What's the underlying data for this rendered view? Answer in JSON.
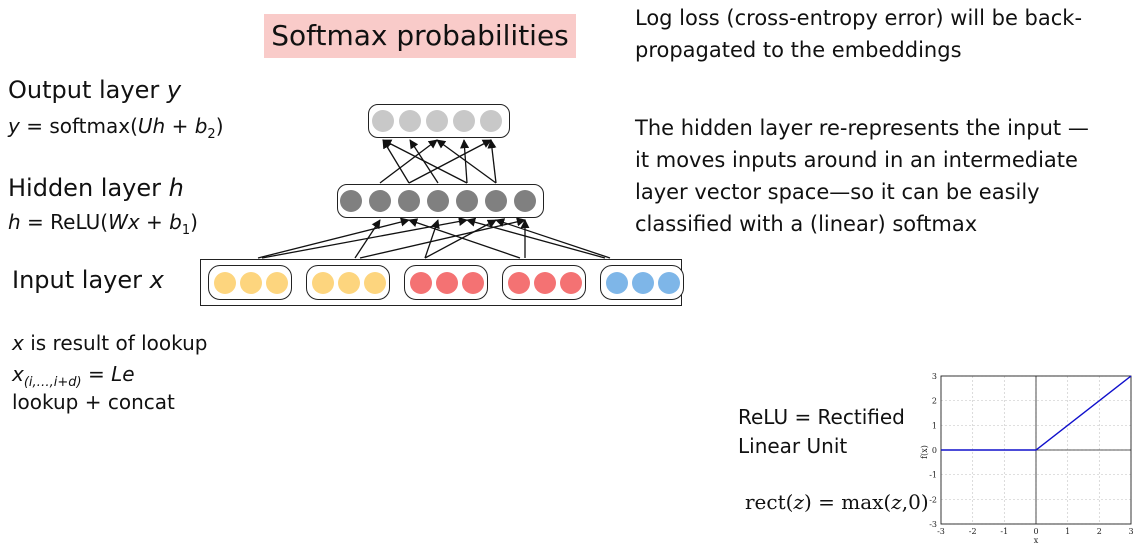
{
  "title": "Softmax probabilities",
  "right_text": {
    "loss_line1": "Log loss (cross-entropy error) will be back-",
    "loss_line2": "propagated to the embeddings",
    "hidden_line1": "The hidden layer re-represents the input —",
    "hidden_line2": "it moves inputs around in an intermediate",
    "hidden_line3": "layer vector space—so it can be easily",
    "hidden_line4": "classified with a (linear) softmax"
  },
  "layers": {
    "output_label": "Output layer ",
    "output_var": "y",
    "output_formula_lhs": "y",
    "output_formula_mid": " = softmax(",
    "output_formula_var": "Uh",
    "output_formula_rest": " + ",
    "output_formula_b": "b",
    "output_formula_sub": "2",
    "output_formula_end": ")",
    "hidden_label": "Hidden layer ",
    "hidden_var": "h",
    "hidden_formula_lhs": "h",
    "hidden_formula_mid": " = ReLU(",
    "hidden_formula_var": "Wx",
    "hidden_formula_rest": " + ",
    "hidden_formula_b": "b",
    "hidden_formula_sub": "1",
    "hidden_formula_end": ")",
    "input_label": "Input layer ",
    "input_var": "x"
  },
  "lookup": {
    "line1_var": "x",
    "line1_rest": " is result of lookup",
    "line2_var": "x",
    "line2_sub": "(i,…,i+d)",
    "line2_eq": " = ",
    "line2_rhs": "Le",
    "line3": "lookup + concat"
  },
  "relu": {
    "line1": "ReLU = Rectified",
    "line2": "Linear Unit",
    "formula_lhs": "rect(",
    "formula_z1": "z",
    "formula_mid": ") = max(",
    "formula_z2": "z",
    "formula_end": ",0)"
  },
  "network": {
    "output_dots": 5,
    "hidden_dots": 7,
    "input_groups": [
      {
        "color": "#fdd57e"
      },
      {
        "color": "#fdd57e"
      },
      {
        "color": "#f47273"
      },
      {
        "color": "#f47273"
      },
      {
        "color": "#7eb6e8"
      }
    ],
    "dots_per_group": 3,
    "output_color": "#c8c8c8",
    "hidden_color": "#808080"
  },
  "chart_data": {
    "type": "line",
    "title": "",
    "xlabel": "x",
    "ylabel": "f(x)",
    "xlim": [
      -3,
      3
    ],
    "ylim": [
      -3,
      3
    ],
    "xticks": [
      "-3",
      "-2",
      "-1",
      "0",
      "1",
      "2",
      "3"
    ],
    "yticks": [
      "3",
      "2",
      "1",
      "0",
      "-1",
      "-2",
      "-3"
    ],
    "grid": true,
    "series": [
      {
        "x": [
          -3,
          0,
          3
        ],
        "y": [
          0,
          0,
          3
        ],
        "color": "#1010cc"
      }
    ]
  }
}
